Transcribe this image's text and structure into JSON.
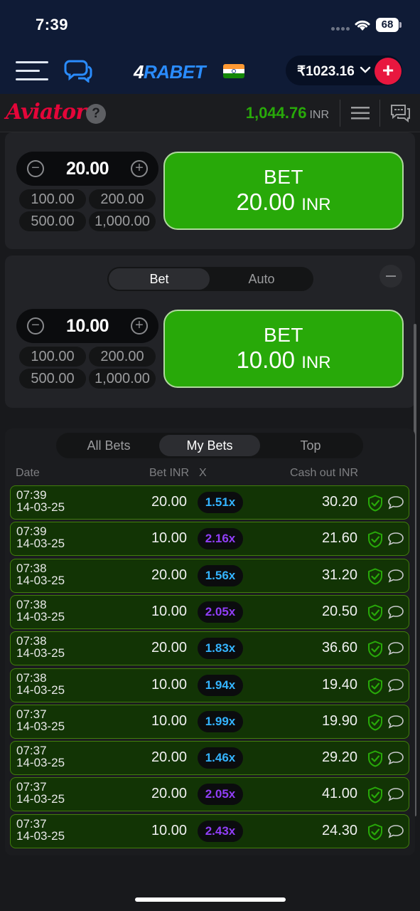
{
  "status_bar": {
    "time": "7:39",
    "battery": "68"
  },
  "top_nav": {
    "logo_four": "4",
    "logo_rest": "RABET",
    "balance": "₹1023.16",
    "add_label": "+"
  },
  "aviator": {
    "logo": "Aviator",
    "help": "?",
    "balance": "1,044.76",
    "currency": "INR"
  },
  "panel1": {
    "amount": "20.00",
    "quick": [
      "100.00",
      "200.00",
      "500.00",
      "1,000.00"
    ],
    "bet_label": "BET",
    "bet_amount": "20.00",
    "bet_currency": "INR"
  },
  "panel2": {
    "tabs": [
      "Bet",
      "Auto"
    ],
    "amount": "10.00",
    "quick": [
      "100.00",
      "200.00",
      "500.00",
      "1,000.00"
    ],
    "bet_label": "BET",
    "bet_amount": "10.00",
    "bet_currency": "INR"
  },
  "bets": {
    "tabs": [
      "All Bets",
      "My Bets",
      "Top"
    ],
    "active_tab": "My Bets",
    "columns": {
      "date": "Date",
      "bet": "Bet INR",
      "x": "X",
      "cashout": "Cash out INR"
    },
    "rows": [
      {
        "time": "07:39",
        "date": "14-03-25",
        "bet": "20.00",
        "mult": "1.51x",
        "color": "#34b4ff",
        "cashout": "30.20"
      },
      {
        "time": "07:39",
        "date": "14-03-25",
        "bet": "10.00",
        "mult": "2.16x",
        "color": "#913ef8",
        "cashout": "21.60"
      },
      {
        "time": "07:38",
        "date": "14-03-25",
        "bet": "20.00",
        "mult": "1.56x",
        "color": "#34b4ff",
        "cashout": "31.20"
      },
      {
        "time": "07:38",
        "date": "14-03-25",
        "bet": "10.00",
        "mult": "2.05x",
        "color": "#913ef8",
        "cashout": "20.50"
      },
      {
        "time": "07:38",
        "date": "14-03-25",
        "bet": "20.00",
        "mult": "1.83x",
        "color": "#34b4ff",
        "cashout": "36.60"
      },
      {
        "time": "07:38",
        "date": "14-03-25",
        "bet": "10.00",
        "mult": "1.94x",
        "color": "#34b4ff",
        "cashout": "19.40"
      },
      {
        "time": "07:37",
        "date": "14-03-25",
        "bet": "10.00",
        "mult": "1.99x",
        "color": "#34b4ff",
        "cashout": "19.90"
      },
      {
        "time": "07:37",
        "date": "14-03-25",
        "bet": "20.00",
        "mult": "1.46x",
        "color": "#34b4ff",
        "cashout": "29.20"
      },
      {
        "time": "07:37",
        "date": "14-03-25",
        "bet": "20.00",
        "mult": "2.05x",
        "color": "#913ef8",
        "cashout": "41.00"
      },
      {
        "time": "07:37",
        "date": "14-03-25",
        "bet": "10.00",
        "mult": "2.43x",
        "color": "#913ef8",
        "cashout": "24.30"
      }
    ]
  },
  "colors": {
    "green": "#28a909",
    "red": "#e50539",
    "blue": "#34b4ff",
    "purple": "#913ef8"
  }
}
